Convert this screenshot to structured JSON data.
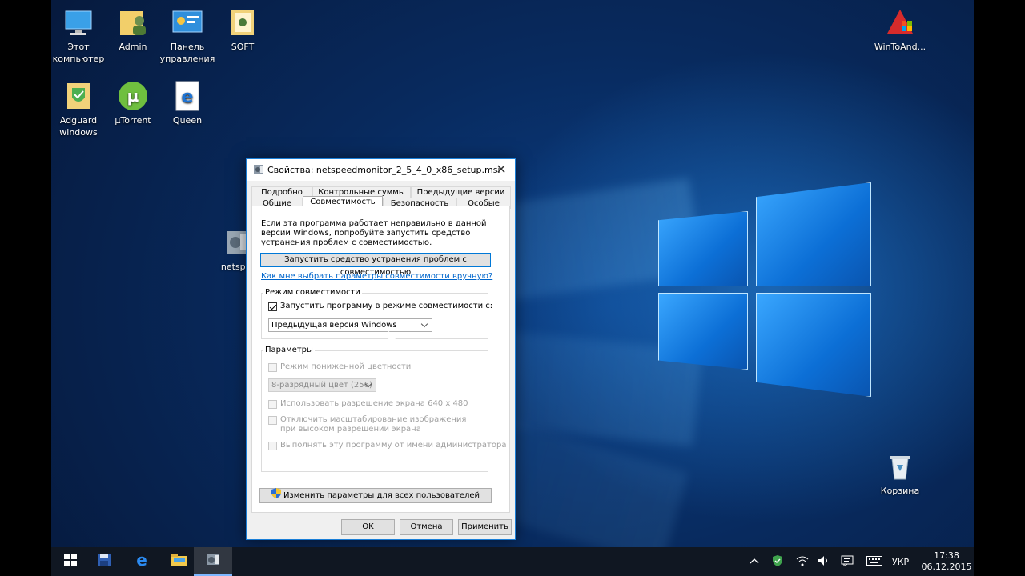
{
  "desktop": {
    "icons": [
      {
        "label": "Этот компьютер",
        "icon": "computer-icon"
      },
      {
        "label": "Admin",
        "icon": "user-folder-icon"
      },
      {
        "label": "Панель управления",
        "icon": "control-panel-icon"
      },
      {
        "label": "SOFT",
        "icon": "folder-icon"
      },
      {
        "label": "Adguard windows",
        "icon": "adguard-icon"
      },
      {
        "label": "µTorrent",
        "icon": "utorrent-icon"
      },
      {
        "label": "Queen",
        "icon": "edge-shortcut-icon"
      },
      {
        "label": "netspee",
        "icon": "installer-icon"
      },
      {
        "label": "WinToAnd...",
        "icon": "wintoand-icon"
      },
      {
        "label": "Корзина",
        "icon": "recycle-bin-icon"
      }
    ]
  },
  "dialog": {
    "title": "Свойства: netspeedmonitor_2_5_4_0_x86_setup.msi",
    "tabs_row1": [
      "Подробно",
      "Контрольные суммы",
      "Предыдущие версии"
    ],
    "tabs_row2": [
      "Общие",
      "Совместимость",
      "Безопасность",
      "Особые"
    ],
    "active_tab": "Совместимость",
    "intro": "Если эта программа работает неправильно в данной версии Windows, попробуйте запустить средство устранения проблем с совместимостью.",
    "troubleshoot_button": "Запустить средство устранения проблем с совместимостью",
    "manual_link": "Как мне выбрать параметры совместимости вручную?",
    "compat_group": {
      "label": "Режим совместимости",
      "checkbox": "Запустить программу в режиме совместимости с:",
      "checked": true,
      "selected_os": "Предыдущая версия Windows"
    },
    "params_group": {
      "label": "Параметры",
      "reduced_color": "Режим пониженной цветности",
      "color_select": "8-разрядный цвет (256)",
      "resolution": "Использовать разрешение экрана 640 x 480",
      "dpi_scaling": "Отключить масштабирование изображения при высоком разрешении экрана",
      "run_as_admin": "Выполнять эту программу от имени администратора"
    },
    "all_users_button": "Изменить параметры для всех пользователей",
    "ok": "OK",
    "cancel": "Отмена",
    "apply": "Применить"
  },
  "taskbar": {
    "language": "УКР",
    "time": "17:38",
    "date": "06.12.2015"
  }
}
